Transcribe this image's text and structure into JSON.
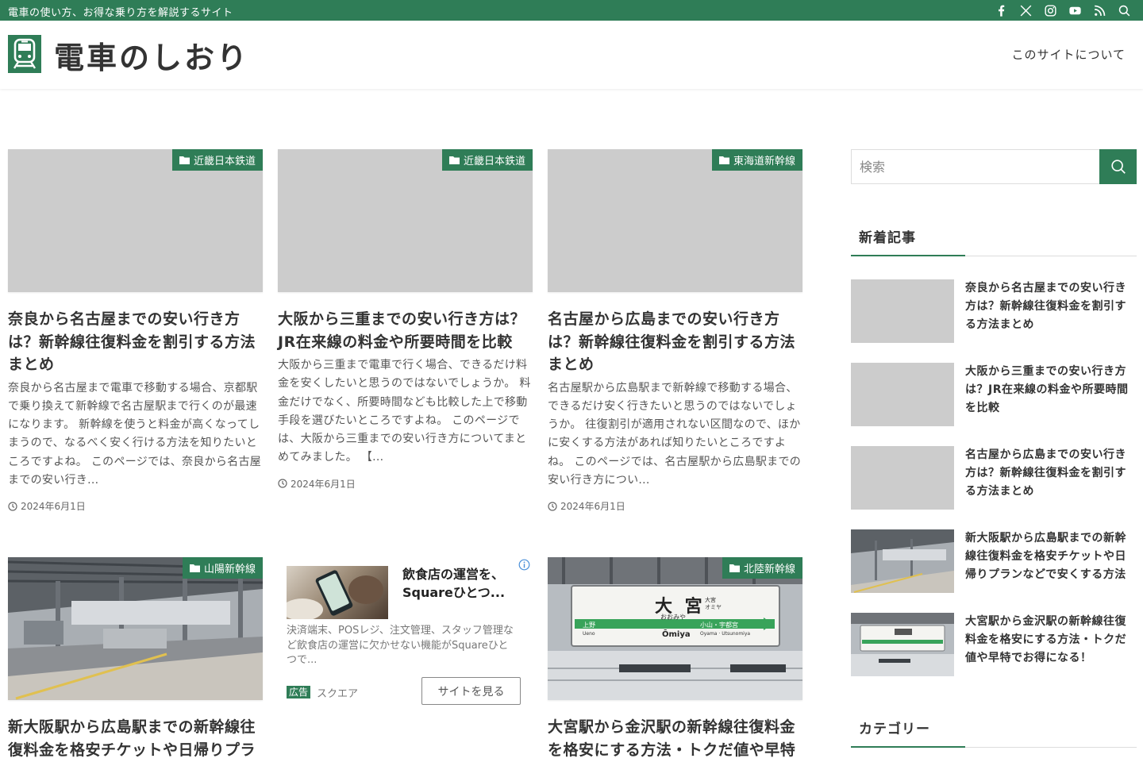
{
  "topbar": {
    "tagline": "電車の使い方、お得な乗り方を解説するサイト",
    "icons": [
      "facebook-icon",
      "x-icon",
      "instagram-icon",
      "youtube-icon",
      "rss-icon",
      "search-icon"
    ]
  },
  "header": {
    "site_title": "電車のしおり",
    "nav": [
      "このサイトについて"
    ]
  },
  "cards": [
    {
      "category": "近畿日本鉄道",
      "title": "奈良から名古屋までの安い行き方は？新幹線往復料金を割引する方法まとめ",
      "excerpt": "奈良から名古屋まで電車で移動する場合、京都駅で乗り換えて新幹線で名古屋駅まで行くのが最速になります。 新幹線を使うと料金が高くなってしまうので、なるべく安く行ける方法を知りたいところですよね。 このページでは、奈良から名古屋までの安い行き...",
      "date": "2024年6月1日"
    },
    {
      "category": "近畿日本鉄道",
      "title": "大阪から三重までの安い行き方は？JR在来線の料金や所要時間を比較",
      "excerpt": "大阪から三重まで電車で行く場合、できるだけ料金を安くしたいと思うのではないでしょうか。 料金だけでなく、所要時間なども比較した上で移動手段を選びたいところですよね。 このページでは、大阪から三重までの安い行き方についてまとめてみました。 【...",
      "date": "2024年6月1日"
    },
    {
      "category": "東海道新幹線",
      "title": "名古屋から広島までの安い行き方は？新幹線往復料金を割引する方法まとめ",
      "excerpt": "名古屋駅から広島駅まで新幹線で移動する場合、できるだけ安く行きたいと思うのではないでしょうか。 往復割引が適用されない区間なので、ほかに安くする方法があれば知りたいところですよね。 このページでは、名古屋駅から広島駅までの安い行き方につい...",
      "date": "2024年6月1日"
    },
    {
      "category": "山陽新幹線",
      "title": "新大阪駅から広島駅までの新幹線往復料金を格安チケットや日帰りプラ"
    },
    {
      "category": "北陸新幹線",
      "title": "大宮駅から金沢駅の新幹線往復料金を格安にする方法・トクだ値や早特",
      "sign": {
        "station": "大 宮",
        "station_small": "大宮\nオミヤ",
        "kana": "おおみや",
        "romaji": "Ōmiya",
        "left_name": "上野",
        "left_romaji": "Ueno",
        "right_name": "小山・宇都宮",
        "right_romaji": "Oyama · Utsunomiya"
      }
    }
  ],
  "ad": {
    "headline": "飲食店の運営を、Squareひとつ...",
    "body": "決済端末、POSレジ、注文管理、スタッフ管理など飲食店の運営に欠かせない機能がSquareひとつで...",
    "badge": "広告",
    "sponsor": "スクエア",
    "cta": "サイトを見る"
  },
  "sidebar": {
    "search_placeholder": "検索",
    "recent_heading": "新着記事",
    "recent": [
      "奈良から名古屋までの安い行き方は？新幹線往復料金を割引する方法まとめ",
      "大阪から三重までの安い行き方は？JR在来線の料金や所要時間を比較",
      "名古屋から広島までの安い行き方は？新幹線往復料金を割引する方法まとめ",
      "新大阪駅から広島駅までの新幹線往復料金を格安チケットや日帰りプランなどで安くする方法",
      "大宮駅から金沢駅の新幹線往復料金を格安にする方法・トクだ値や早特でお得になる！"
    ],
    "category_heading": "カテゴリー"
  },
  "colors": {
    "brand": "#2f7d57",
    "placeholder": "#cccccc",
    "text": "#333333"
  }
}
